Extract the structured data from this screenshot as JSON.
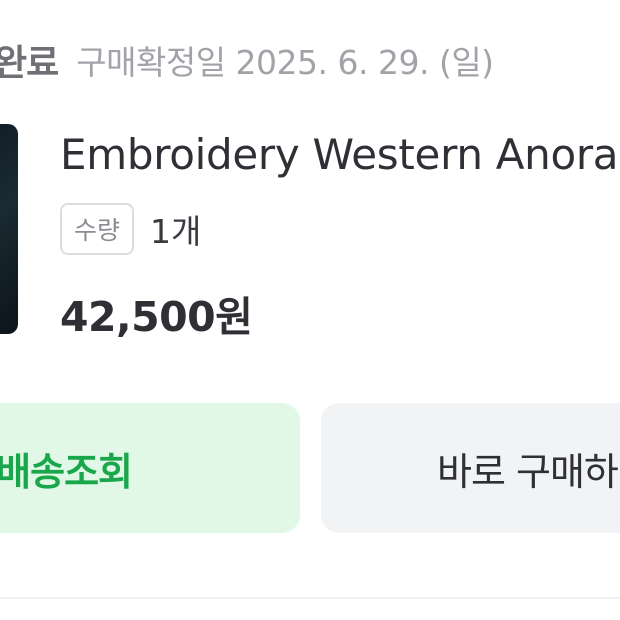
{
  "order": {
    "status_label": "완료",
    "confirm_date": "구매확정일 2025. 6. 29. (일)"
  },
  "product": {
    "name": "Embroidery Western Anora",
    "quantity_label": "수량",
    "quantity_value": "1개",
    "price": "42,500원"
  },
  "actions": {
    "track_delivery_label": "배송조회",
    "rebuy_label": "바로 구매하"
  },
  "colors": {
    "track_button_bg": "#e2f8e7",
    "track_button_text": "#1aa64a",
    "rebuy_button_bg": "#f2f3f5",
    "text_primary": "#2f3036",
    "text_muted": "#a2a3a8"
  }
}
